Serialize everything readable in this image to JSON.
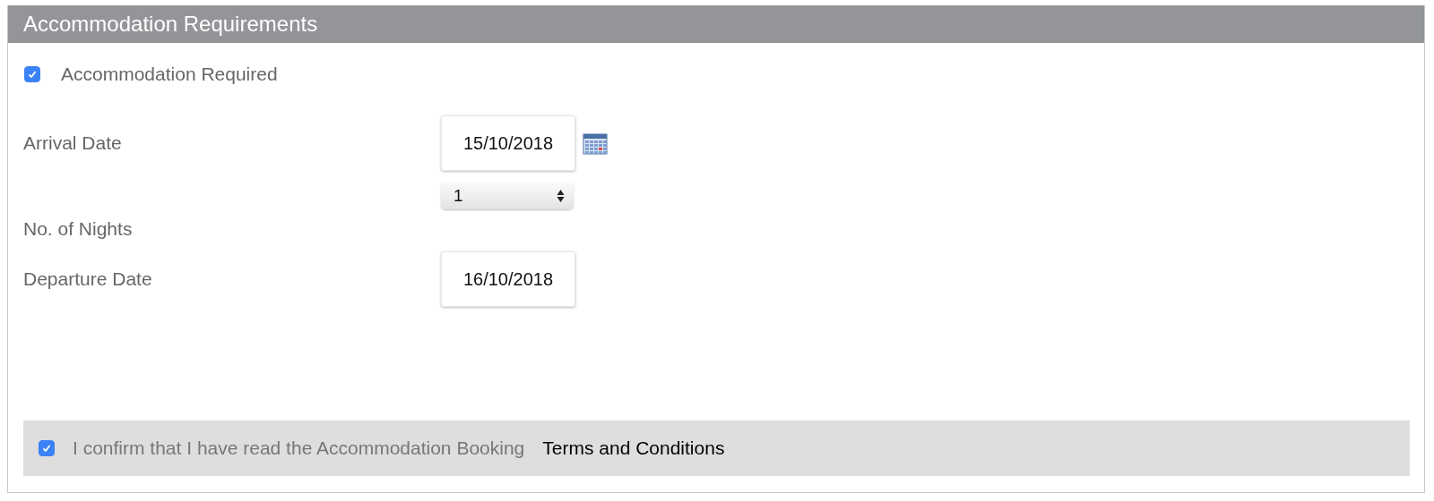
{
  "panel": {
    "title": "Accommodation Requirements"
  },
  "required": {
    "label": "Accommodation Required",
    "checked": true
  },
  "fields": [
    {
      "kind": "date",
      "label": "Arrival Date",
      "value": "15/10/2018",
      "calendar": true
    },
    {
      "kind": "select",
      "label": "No. of Nights",
      "value": "1"
    },
    {
      "kind": "date",
      "label": "Departure Date",
      "value": "16/10/2018",
      "calendar": false
    }
  ],
  "confirm": {
    "text": "I confirm that I have read the Accommodation Booking",
    "link": "Terms and Conditions",
    "checked": true
  }
}
